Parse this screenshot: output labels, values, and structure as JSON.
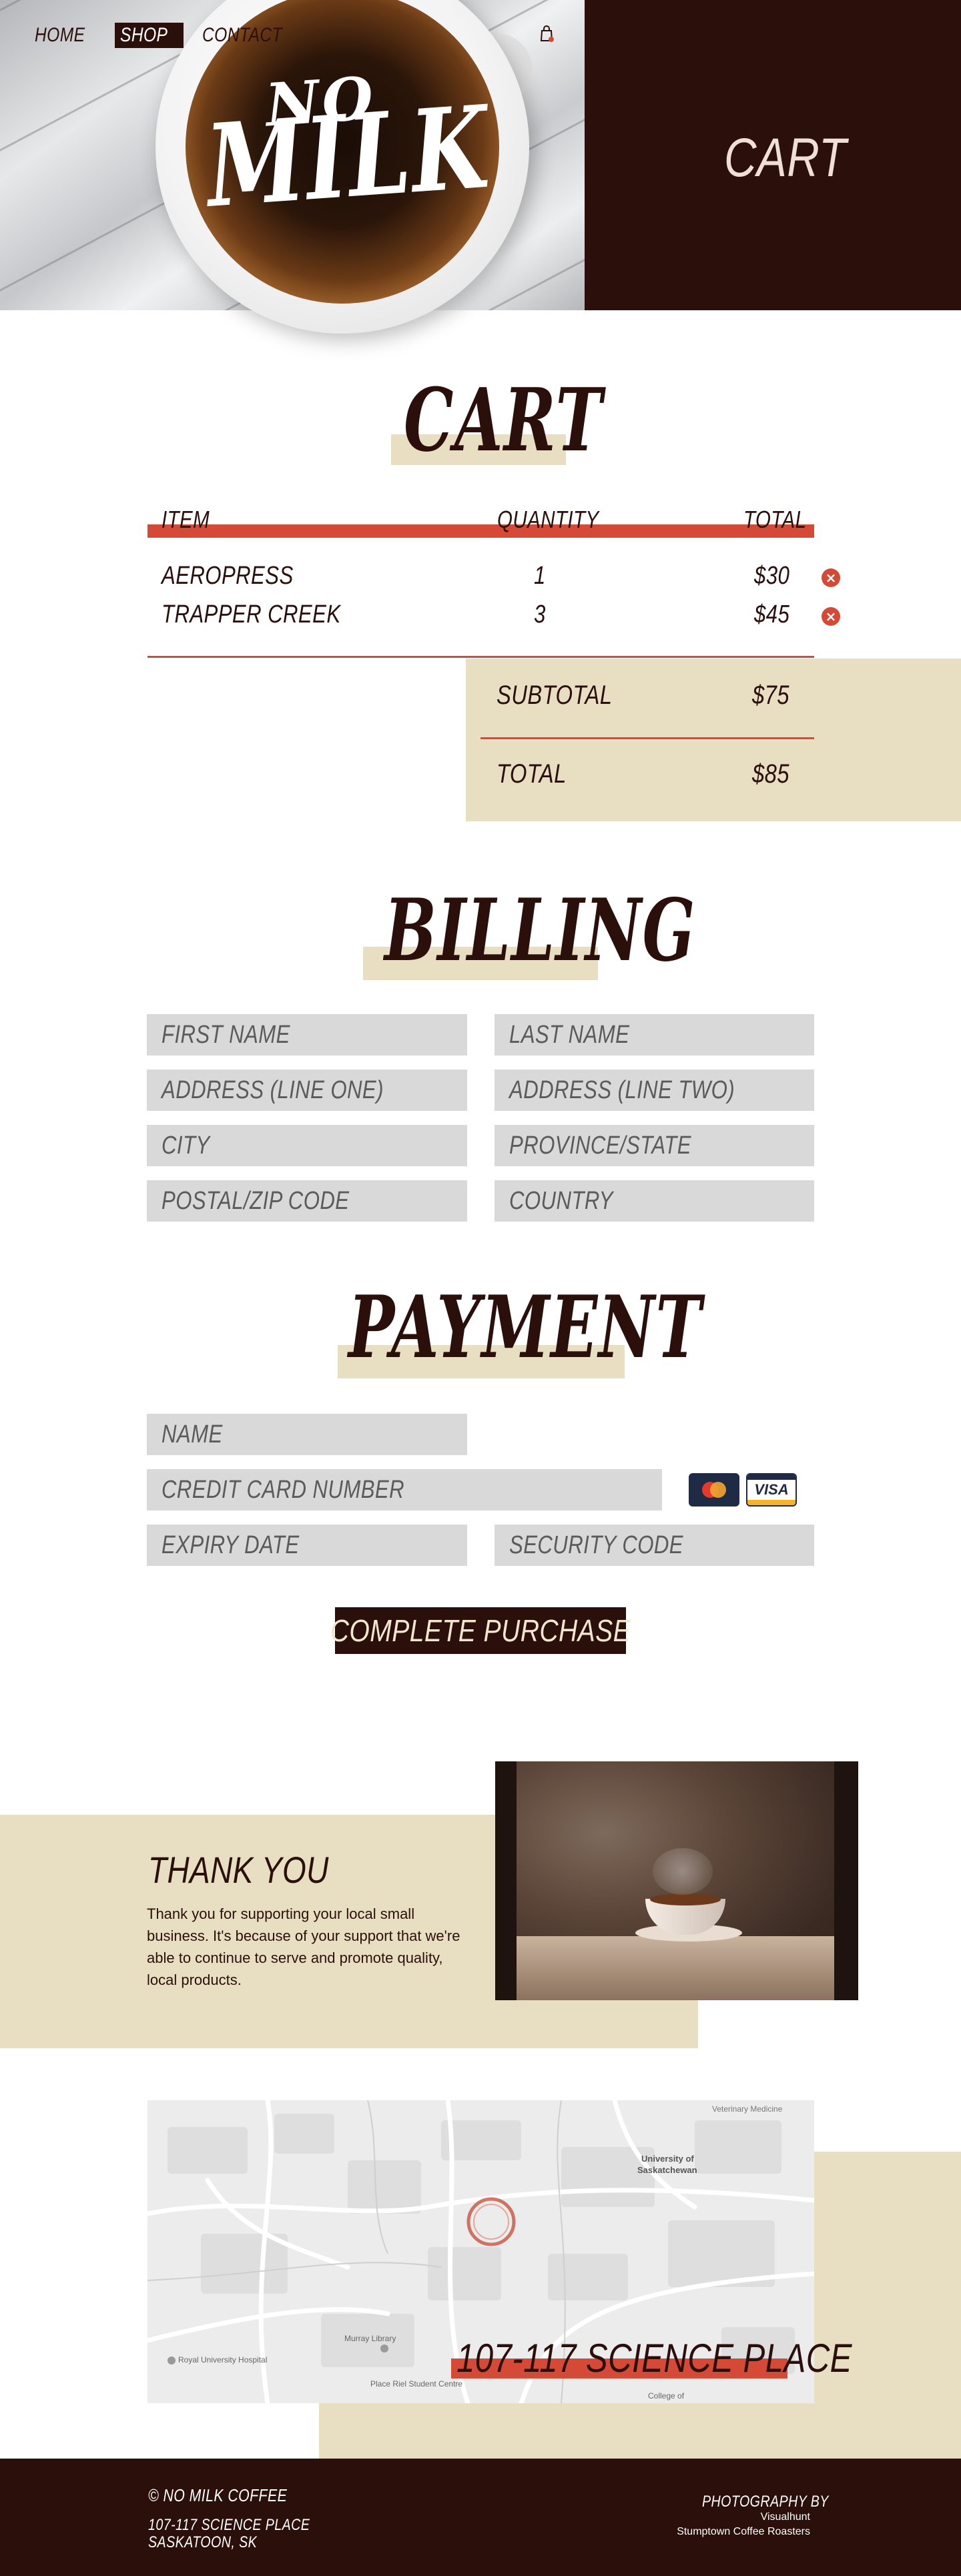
{
  "nav": {
    "links": [
      {
        "label": "HOME",
        "active": false
      },
      {
        "label": "SHOP",
        "active": true
      },
      {
        "label": "CONTACT",
        "active": false
      }
    ],
    "cart_icon": "shopping-bag-icon"
  },
  "hero": {
    "logo_line1": "NO",
    "logo_line2": "MILK",
    "panel_title": "CART"
  },
  "cart": {
    "title": "CART",
    "columns": {
      "item": "ITEM",
      "quantity": "QUANTITY",
      "total": "TOTAL"
    },
    "rows": [
      {
        "item": "AEROPRESS",
        "quantity": "1",
        "total": "$30"
      },
      {
        "item": "TRAPPER CREEK",
        "quantity": "3",
        "total": "$45"
      }
    ],
    "subtotal_label": "SUBTOTAL",
    "subtotal_value": "$75",
    "total_label": "TOTAL",
    "total_value": "$85"
  },
  "billing": {
    "title": "BILLING",
    "fields": {
      "first_name": "FIRST NAME",
      "last_name": "LAST NAME",
      "address1": "ADDRESS (LINE ONE)",
      "address2": "ADDRESS (LINE TWO)",
      "city": "CITY",
      "province": "PROVINCE/STATE",
      "postal": "POSTAL/ZIP CODE",
      "country": "COUNTRY"
    }
  },
  "payment": {
    "title": "PAYMENT",
    "fields": {
      "name": "NAME",
      "card_number": "CREDIT CARD NUMBER",
      "expiry": "EXPIRY DATE",
      "security": "SECURITY CODE"
    },
    "visa_label": "VISA",
    "button_label": "COMPLETE PURCHASE"
  },
  "thanks": {
    "title": "THANK YOU",
    "body": "Thank you for supporting your local small business. It's because of your support that we're able to continue to serve and promote quality, local products."
  },
  "map": {
    "address": "107-117 SCIENCE PLACE",
    "labels": {
      "veterinary": "Veterinary Medicine",
      "university_1": "University of",
      "university_2": "Saskatchewan",
      "library": "Murray Library",
      "hospital": "Royal University Hospital",
      "student_centre": "Place Riel Student Centre",
      "college": "College of"
    }
  },
  "footer": {
    "copyright": "© NO MILK COFFEE",
    "address_line1": "107-117 SCIENCE PLACE",
    "address_line2": "SASKATOON, SK",
    "photo_heading": "PHOTOGRAPHY BY",
    "photo_credit1": "Visualhunt",
    "photo_credit2": "Stumptown Coffee Roasters"
  },
  "colors": {
    "brown": "#2b0f0b",
    "accent_red": "#d44a36",
    "beige": "#e8dfc2",
    "field_grey": "#d9d9d9"
  }
}
